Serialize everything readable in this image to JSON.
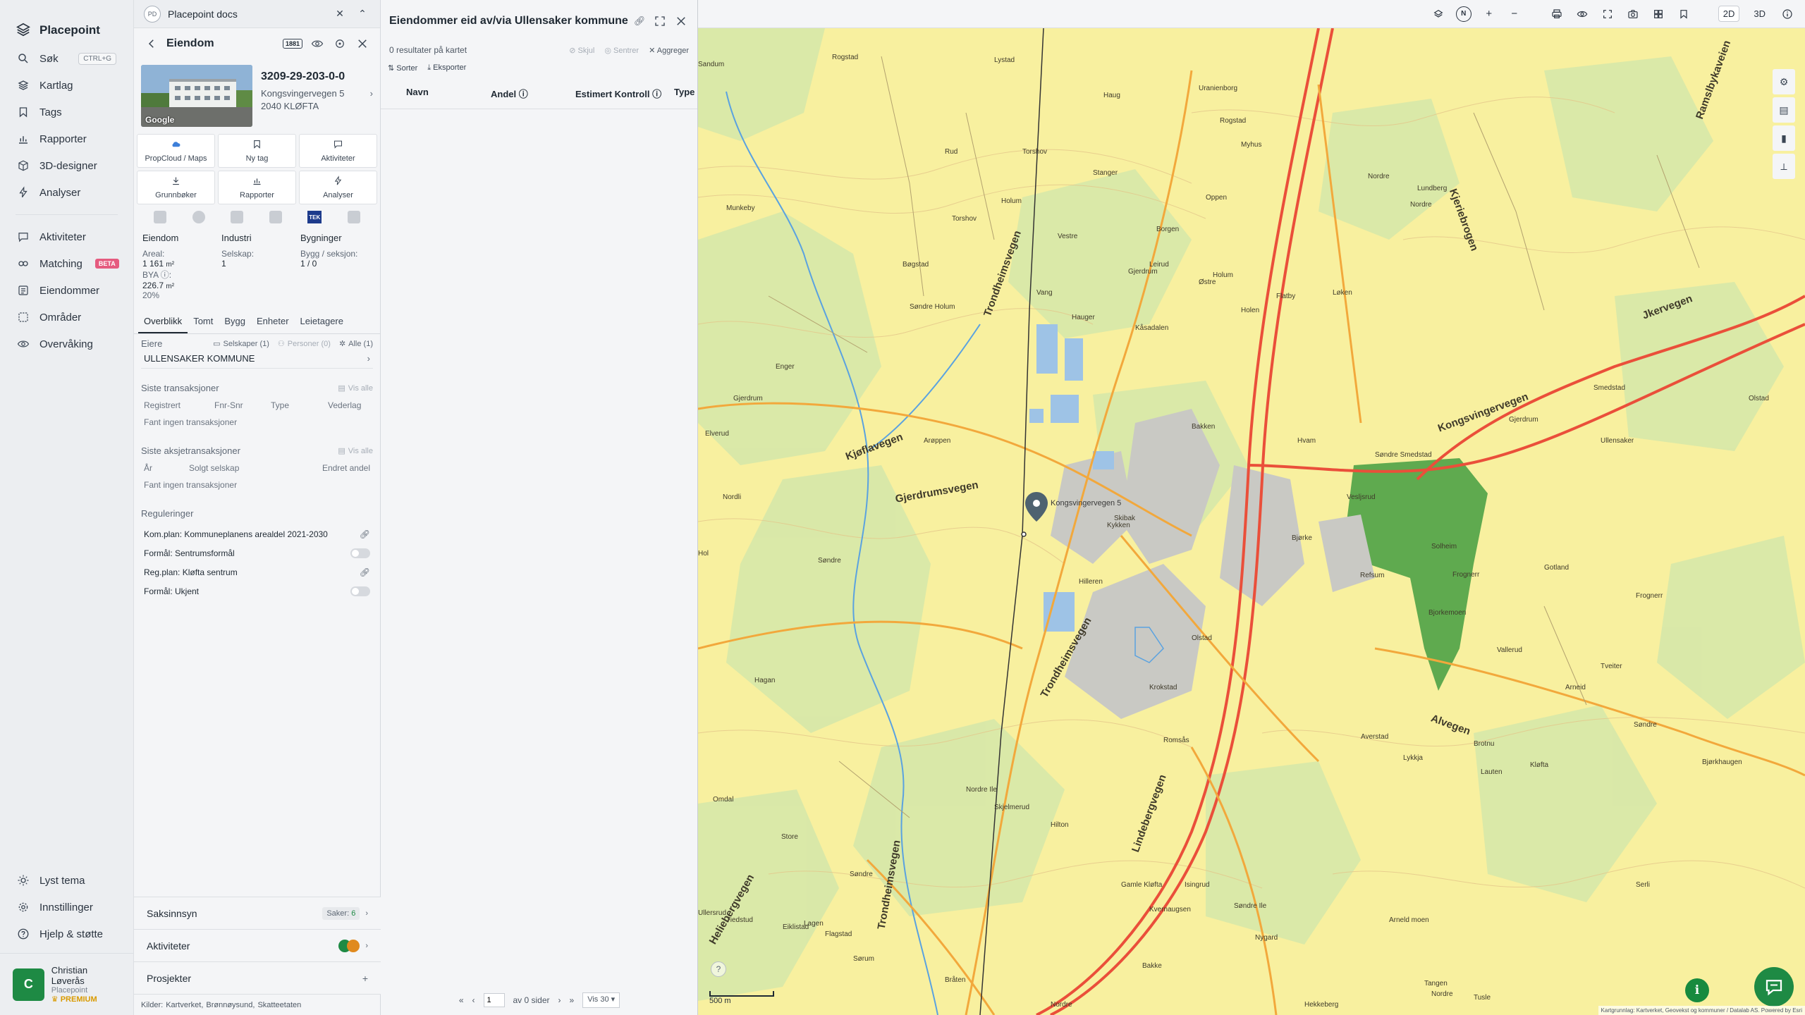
{
  "app": {
    "name": "Placepoint"
  },
  "nav": {
    "items": [
      {
        "label": "Søk",
        "shortcut": "CTRL+G",
        "icon": "search-icon"
      },
      {
        "label": "Kartlag",
        "icon": "layers-icon"
      },
      {
        "label": "Tags",
        "icon": "bookmark-icon"
      },
      {
        "label": "Rapporter",
        "icon": "bar-chart-icon"
      },
      {
        "label": "3D-designer",
        "icon": "cube-icon"
      },
      {
        "label": "Analyser",
        "icon": "bolt-icon"
      }
    ],
    "items2": [
      {
        "label": "Aktiviteter",
        "icon": "chat-icon"
      },
      {
        "label": "Matching",
        "badge": "BETA",
        "icon": "link-icon"
      },
      {
        "label": "Eiendommer",
        "icon": "list-icon"
      },
      {
        "label": "Områder",
        "icon": "area-icon"
      },
      {
        "label": "Overvåking",
        "icon": "eye-icon"
      }
    ],
    "bottom": [
      {
        "label": "Lyst tema",
        "icon": "sun-icon"
      },
      {
        "label": "Innstillinger",
        "icon": "gear-icon"
      },
      {
        "label": "Hjelp & støtte",
        "icon": "help-icon"
      }
    ],
    "user": {
      "initial": "C",
      "name": "Christian Løverås",
      "org": "Placepoint",
      "tier": "PREMIUM"
    }
  },
  "doc_tab": {
    "badge": "PD",
    "title": "Placepoint docs"
  },
  "property": {
    "header": "Eiendom",
    "tag_mini": "1881",
    "id": "3209-29-203-0-0",
    "street": "Kongsvingervegen 5",
    "postal": "2040 KLØFTA",
    "photo_label": "Google",
    "quick": [
      {
        "label": "PropCloud / Maps",
        "icon": "propcloud-icon"
      },
      {
        "label": "Ny tag",
        "icon": "bookmark-icon"
      },
      {
        "label": "Aktiviteter",
        "icon": "chat-icon"
      },
      {
        "label": "Grunnbøker",
        "icon": "download-icon"
      },
      {
        "label": "Rapporter",
        "icon": "bar-chart-icon"
      },
      {
        "label": "Analyser",
        "icon": "bolt-icon"
      }
    ],
    "source_tek": "TEK",
    "facts": {
      "col1_h": "Eiendom",
      "areal_l": "Areal:",
      "areal_v": "1 161",
      "areal_u": "m²",
      "bya_l": "BYA ⓘ:",
      "bya_v": "226.7",
      "bya_u": "m²",
      "bya_pct": "20%",
      "col2_h": "Industri",
      "selskap_l": "Selskap:",
      "selskap_v": "1",
      "col3_h": "Bygninger",
      "bygg_l": "Bygg / seksjon:",
      "bygg_v": "1 / 0"
    },
    "tabs": [
      "Overblikk",
      "Tomt",
      "Bygg",
      "Enheter",
      "Leietagere"
    ],
    "owners": {
      "label": "Eiere",
      "f1": "Selskaper (1)",
      "f2": "Personer (0)",
      "f3": "Alle (1)",
      "row": "ULLENSAKER KOMMUNE"
    },
    "transactions": {
      "title": "Siste transaksjoner",
      "vis_alle": "Vis alle",
      "cols": [
        "Registrert",
        "Fnr-Snr",
        "Type",
        "Vederlag"
      ],
      "empty": "Fant ingen transaksjoner"
    },
    "share_transactions": {
      "title": "Siste aksjetransaksjoner",
      "vis_alle": "Vis alle",
      "cols": [
        "År",
        "Solgt selskap",
        "Endret andel"
      ],
      "empty": "Fant ingen transaksjoner"
    },
    "regulations": {
      "title": "Reguleringer",
      "rows": [
        "Kom.plan: Kommuneplanens arealdel 2021-2030",
        "Formål: Sentrumsformål",
        "Reg.plan: Kløfta sentrum",
        "Formål: Ukjent"
      ]
    },
    "accordion": {
      "saksinnsyn": "Saksinnsyn",
      "saker_label": "Saker:",
      "saker_count": "6",
      "aktiviteter": "Aktiviteter",
      "prosjekter": "Prosjekter"
    },
    "kilder": {
      "label": "Kilder:",
      "items": [
        "Kartverket,",
        "Brønnøysund,",
        "Skatteetaten"
      ]
    }
  },
  "results": {
    "title": "Eiendommer eid av/via Ullensaker kommune",
    "count_text": "0 resultater på kartet",
    "actions": {
      "skjul": "Skjul",
      "sentrer": "Sentrer",
      "aggreger": "Aggreger"
    },
    "tools": {
      "sort": "Sorter",
      "export": "Eksporter"
    },
    "columns": [
      "Navn",
      "Andel ⓘ",
      "Estimert Kontroll ⓘ",
      "Type"
    ],
    "pager": {
      "page": "1",
      "of_text": "av 0 sider",
      "per_page": "Vis 30"
    }
  },
  "map": {
    "modes": [
      "2D",
      "3D"
    ],
    "scale": "500 m",
    "attribution": "Kartgrunnlag: Kartverket, Geovekst og kommuner / Datalab AS. Powered by Esri",
    "marker_label": "Kongsvingervegen 5",
    "places": [
      "Sandum",
      "Rogstad",
      "Lystad",
      "Haug",
      "Uranienborg",
      "Rogstad",
      "Myhus",
      "Torshov",
      "Stanger",
      "Rud",
      "Oppen",
      "Munkeby",
      "Torshov",
      "Nordre",
      "Holum",
      "Lundberg",
      "Vestre",
      "Borgen",
      "Leirud",
      "Nordre",
      "Holum",
      "Østre",
      "Bøgstad",
      "Løken",
      "Vang",
      "Gjerdrum",
      "Flatby",
      "Enger",
      "Søndre Holum",
      "Holen",
      "Gjerdrum",
      "Olstad",
      "Elverud",
      "Hvam",
      "Hauger",
      "Bakken",
      "Kåsadalen",
      "Smedstad",
      "Arøppen",
      "Gjerdrum",
      "Ullensaker",
      "Søndre Smedstad",
      "Averstad",
      "Lauten",
      "Hol",
      "Vesljsrud",
      "Solheim",
      "Skibak",
      "Kykken",
      "Frognerr",
      "Nordli",
      "Hilleren",
      "Gotland",
      "Frognerr",
      "Søndre",
      "Olstad",
      "Tveiter",
      "Krokstad",
      "Lykkja",
      "Hagan",
      "Kløfta",
      "Serli",
      "Hilton",
      "Ullersrud",
      "Sørum",
      "Romsås",
      "Nordre Ile",
      "Gamle Kløfta",
      "Bakke",
      "Brotnu",
      "Isingrud",
      "Søndre Ile",
      "Nygard",
      "Eiklistad",
      "Tiedstud",
      "Flagstad",
      "Arneld moen",
      "Skjelmerud",
      "Kvernaugsen",
      "Tangen",
      "Bråten",
      "Nordre",
      "Lagen",
      "Tusle",
      "Nordre",
      "Hekkeberg",
      "Bjørke",
      "Refsum",
      "Bjorkemoen",
      "Vallerud",
      "Arneid",
      "Søndre",
      "Bjørkhaugen",
      "Omdal",
      "Store",
      "Søndre"
    ],
    "roads": [
      "Kjøflavegen",
      "Gjerdrumsvegen",
      "Trondheimsvegen",
      "Kongsvingervegen",
      "Jkervegen",
      "Kjeriebrogen",
      "Trondheimsvegen",
      "Lindebergvegen",
      "Heliebergvegen",
      "Trondheimsvegen",
      "Alvegen",
      "Ramslbykaveien"
    ]
  }
}
